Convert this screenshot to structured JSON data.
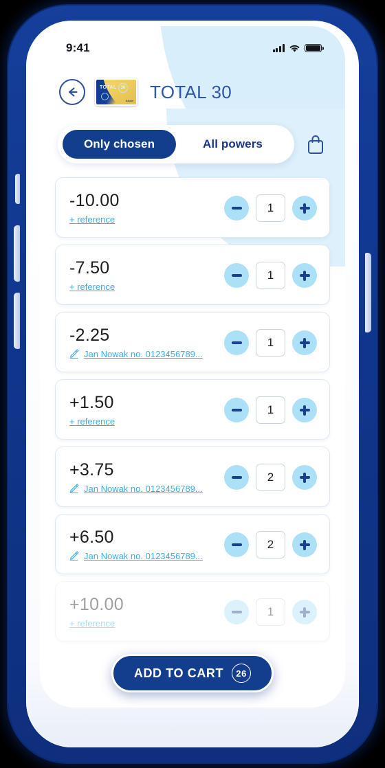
{
  "status_bar": {
    "time": "9:41",
    "signal_icon": "signal-bars-icon",
    "wifi_icon": "wifi-icon",
    "battery_icon": "battery-full-icon"
  },
  "header": {
    "back_icon": "back-arrow-icon",
    "product_thumbnail": {
      "brand_text": "TOTAL",
      "badge_text": "30",
      "footer_text": "Alcon"
    },
    "title": "TOTAL 30"
  },
  "toolbar": {
    "tabs": [
      {
        "label": "Only chosen",
        "active": true
      },
      {
        "label": "All powers",
        "active": false
      }
    ],
    "bag_icon": "shopping-bag-icon"
  },
  "list": {
    "rows": [
      {
        "power": "-10.00",
        "link": "+ reference",
        "has_edit_icon": false,
        "qty": "1"
      },
      {
        "power": "-7.50",
        "link": "+ reference",
        "has_edit_icon": false,
        "qty": "1"
      },
      {
        "power": "-2.25",
        "link": "Jan Nowak no. 0123456789...",
        "has_edit_icon": true,
        "qty": "1"
      },
      {
        "power": "+1.50",
        "link": "+ reference",
        "has_edit_icon": false,
        "qty": "1"
      },
      {
        "power": "+3.75",
        "link": "Jan Nowak no. 0123456789...",
        "has_edit_icon": true,
        "qty": "2"
      },
      {
        "power": "+6.50",
        "link": "Jan Nowak no. 0123456789...",
        "has_edit_icon": true,
        "qty": "2"
      },
      {
        "power": "+10.00",
        "link": "+ reference",
        "has_edit_icon": false,
        "qty": "1"
      }
    ],
    "decrement_icon": "minus-icon",
    "increment_icon": "plus-icon",
    "edit_icon": "pencil-edit-icon"
  },
  "cta": {
    "label": "ADD TO CART",
    "count": "26"
  },
  "colors": {
    "brand_navy": "#133d8d",
    "title_blue": "#2d57a8",
    "link_blue": "#38aeef",
    "step_bg": "#ace0f7",
    "blob_blue": "#d9eefb",
    "frame_blue": "#10368c"
  }
}
